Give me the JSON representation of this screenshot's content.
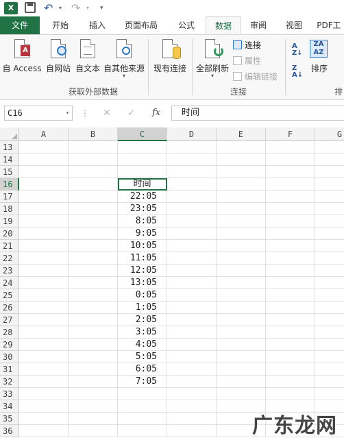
{
  "qat": {
    "logo": "X",
    "undo_icon": "↶",
    "redo_icon": "↷",
    "dropdown": "▾"
  },
  "tabs": [
    "文件",
    "开始",
    "插入",
    "页面布局",
    "公式",
    "数据",
    "审阅",
    "视图",
    "PDF工"
  ],
  "ribbon": {
    "get_external": {
      "access": "自 Access",
      "web": "自网站",
      "text": "自文本",
      "other": "自其他来源",
      "other_dropdown": "▾",
      "group_label": "获取外部数据"
    },
    "existing": "现有连接",
    "connections": {
      "refresh_all": "全部刷新",
      "refresh_dropdown": "▾",
      "connect": "连接",
      "properties": "属性",
      "edit_links": "编辑链接",
      "group_label": "连接"
    },
    "sort": {
      "label": "排序",
      "group_label": "排"
    }
  },
  "formula_bar": {
    "name_box": "C16",
    "dropdown": "▾",
    "dots": "⋮",
    "cancel": "✕",
    "enter": "✓",
    "fx": "fx",
    "value": "时间"
  },
  "grid": {
    "columns": [
      "A",
      "B",
      "C",
      "D",
      "E",
      "F",
      "G"
    ],
    "rows": [
      {
        "n": "13",
        "c": ""
      },
      {
        "n": "14",
        "c": ""
      },
      {
        "n": "15",
        "c": ""
      },
      {
        "n": "16",
        "c": "时间"
      },
      {
        "n": "17",
        "c": "22:05"
      },
      {
        "n": "18",
        "c": "23:05"
      },
      {
        "n": "19",
        "c": "8:05"
      },
      {
        "n": "20",
        "c": "9:05"
      },
      {
        "n": "21",
        "c": "10:05"
      },
      {
        "n": "22",
        "c": "11:05"
      },
      {
        "n": "23",
        "c": "12:05"
      },
      {
        "n": "24",
        "c": "13:05"
      },
      {
        "n": "25",
        "c": "0:05"
      },
      {
        "n": "26",
        "c": "1:05"
      },
      {
        "n": "27",
        "c": "2:05"
      },
      {
        "n": "28",
        "c": "3:05"
      },
      {
        "n": "29",
        "c": "4:05"
      },
      {
        "n": "30",
        "c": "5:05"
      },
      {
        "n": "31",
        "c": "6:05"
      },
      {
        "n": "32",
        "c": "7:05"
      },
      {
        "n": "33",
        "c": ""
      },
      {
        "n": "34",
        "c": ""
      },
      {
        "n": "35",
        "c": ""
      },
      {
        "n": "36",
        "c": ""
      }
    ]
  },
  "watermark": "广东龙网"
}
